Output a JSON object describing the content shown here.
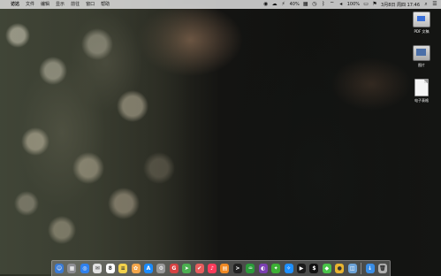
{
  "menubar": {
    "apple": "",
    "items": [
      "访达",
      "文件",
      "编辑",
      "显示",
      "前往",
      "窗口",
      "帮助"
    ],
    "status": {
      "left_glyph": "◉",
      "percent_mid": "40%",
      "battery": "100%",
      "datetime": "3月8日 周四 17:46"
    }
  },
  "desktop_icons": [
    {
      "label": "PDF 文稿",
      "icon": "pdf-file-icon"
    },
    {
      "label": "图片",
      "icon": "image-file-icon"
    },
    {
      "label": "电子表格",
      "icon": "document-file-icon"
    }
  ],
  "dock": {
    "items": [
      {
        "name": "finder",
        "color": "#3a7bd5",
        "glyph": "☺"
      },
      {
        "name": "launchpad",
        "color": "#8e8e93",
        "glyph": "▦"
      },
      {
        "name": "safari",
        "color": "#2f80ed",
        "glyph": "◎"
      },
      {
        "name": "mail",
        "color": "#e0e0e0",
        "glyph": "✉"
      },
      {
        "name": "calendar",
        "color": "#ffffff",
        "glyph": "8"
      },
      {
        "name": "notes",
        "color": "#f2d14b",
        "glyph": "≡"
      },
      {
        "name": "photos",
        "color": "#f3a64b",
        "glyph": "✿"
      },
      {
        "name": "app-store",
        "color": "#1a8cff",
        "glyph": "A"
      },
      {
        "name": "system-preferences",
        "color": "#9a9a9a",
        "glyph": "⚙"
      },
      {
        "name": "chrome-like",
        "color": "#d64242",
        "glyph": "G"
      },
      {
        "name": "maps",
        "color": "#4caf50",
        "glyph": "➤"
      },
      {
        "name": "reminders",
        "color": "#e75d5d",
        "glyph": "✔"
      },
      {
        "name": "music",
        "color": "#fb3b5b",
        "glyph": "♪"
      },
      {
        "name": "books",
        "color": "#f08a24",
        "glyph": "▤"
      },
      {
        "name": "terminal",
        "color": "#222222",
        "glyph": ">"
      },
      {
        "name": "activity-monitor",
        "color": "#2b9b3a",
        "glyph": "♒"
      },
      {
        "name": "photo-booth",
        "color": "#7b3fb1",
        "glyph": "◐"
      },
      {
        "name": "wechat",
        "color": "#3cb034",
        "glyph": "✦"
      },
      {
        "name": "qq",
        "color": "#1e90ff",
        "glyph": "✧"
      },
      {
        "name": "quicktime",
        "color": "#1a1a1a",
        "glyph": "▶"
      },
      {
        "name": "iterm",
        "color": "#111111",
        "glyph": "$"
      },
      {
        "name": "green-app",
        "color": "#49c449",
        "glyph": "◆"
      },
      {
        "name": "chrome",
        "color": "#e8b430",
        "glyph": "●"
      },
      {
        "name": "preview",
        "color": "#6da3d8",
        "glyph": "◫"
      },
      {
        "name": "downloads",
        "color": "#3a8ee6",
        "glyph": "↓"
      },
      {
        "name": "trash",
        "color": "#b0b0b0",
        "glyph": "🗑"
      }
    ]
  }
}
